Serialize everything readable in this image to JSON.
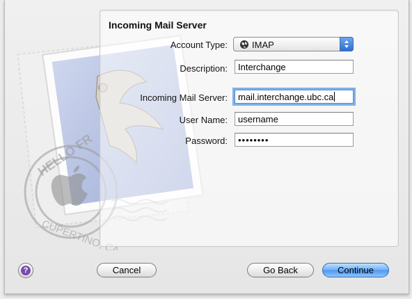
{
  "dialog": {
    "section_title": "Incoming Mail Server"
  },
  "stamp": {
    "text_top": "HELLO FR",
    "text_bottom": "CUPERTINO, CA"
  },
  "form": {
    "account_type": {
      "label": "Account Type:",
      "value": "IMAP",
      "icon": "globe-icon"
    },
    "description": {
      "label": "Description:",
      "value": "Interchange"
    },
    "incoming_server": {
      "label": "Incoming Mail Server:",
      "value": "mail.interchange.ubc.ca"
    },
    "user_name": {
      "label": "User Name:",
      "value": "username"
    },
    "password": {
      "label": "Password:",
      "value": "••••••••"
    }
  },
  "buttons": {
    "help": "?",
    "cancel": "Cancel",
    "go_back": "Go Back",
    "continue": "Continue"
  },
  "colors": {
    "accent": "#4a97ee",
    "focus_ring": "#7fb0e6",
    "help_badge": "#7a4bb0"
  }
}
